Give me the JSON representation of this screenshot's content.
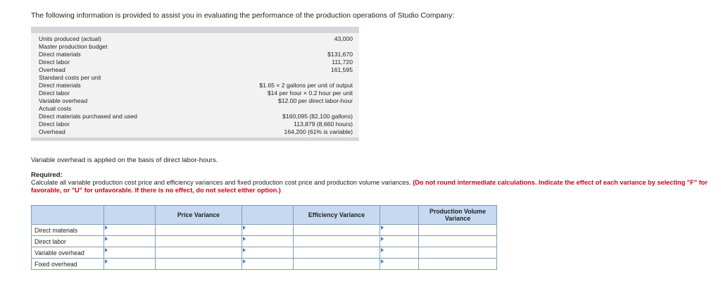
{
  "intro": "The following information is provided to assist you in evaluating the performance of the production operations of Studio Company:",
  "info_rows": [
    {
      "label": "Units produced (actual)",
      "value": "43,000"
    },
    {
      "label": "Master production budget",
      "value": ""
    },
    {
      "label": "Direct materials",
      "value": "$131,670"
    },
    {
      "label": "Direct labor",
      "value": "111,720"
    },
    {
      "label": "Overhead",
      "value": "161,595"
    },
    {
      "label": "Standard costs per unit",
      "value": ""
    },
    {
      "label": "Direct materials",
      "value": "$1.65 × 2 gallons per unit of output"
    },
    {
      "label": "Direct labor",
      "value": "$14 per hour × 0.2 hour per unit"
    },
    {
      "label": "Variable overhead",
      "value": "$12.00 per direct labor-hour"
    },
    {
      "label": "Actual costs",
      "value": ""
    },
    {
      "label": "Direct materials purchased and used",
      "value": "$160,095 (82,100 gallons)"
    },
    {
      "label": "Direct labor",
      "value": "113,879 (8,660 hours)"
    },
    {
      "label": "Overhead",
      "value": "164,200 (61% is variable)"
    }
  ],
  "note": "Variable overhead is applied on the basis of direct labor-hours.",
  "required": {
    "title": "Required:",
    "text": "Calculate all variable production cost price and efficiency variances and fixed production cost price and production volume variances.",
    "instruction": "(Do not round intermediate calculations. Indicate the effect of each variance by selecting \"F\" for favorable, or \"U\" for unfavorable. If there is no effect, do not select either option.)"
  },
  "table": {
    "headers": [
      "Price Variance",
      "Efficiency Variance",
      "Production Volume Variance"
    ],
    "rows": [
      "Direct materials",
      "Direct labor",
      "Variable overhead",
      "Fixed overhead"
    ]
  }
}
